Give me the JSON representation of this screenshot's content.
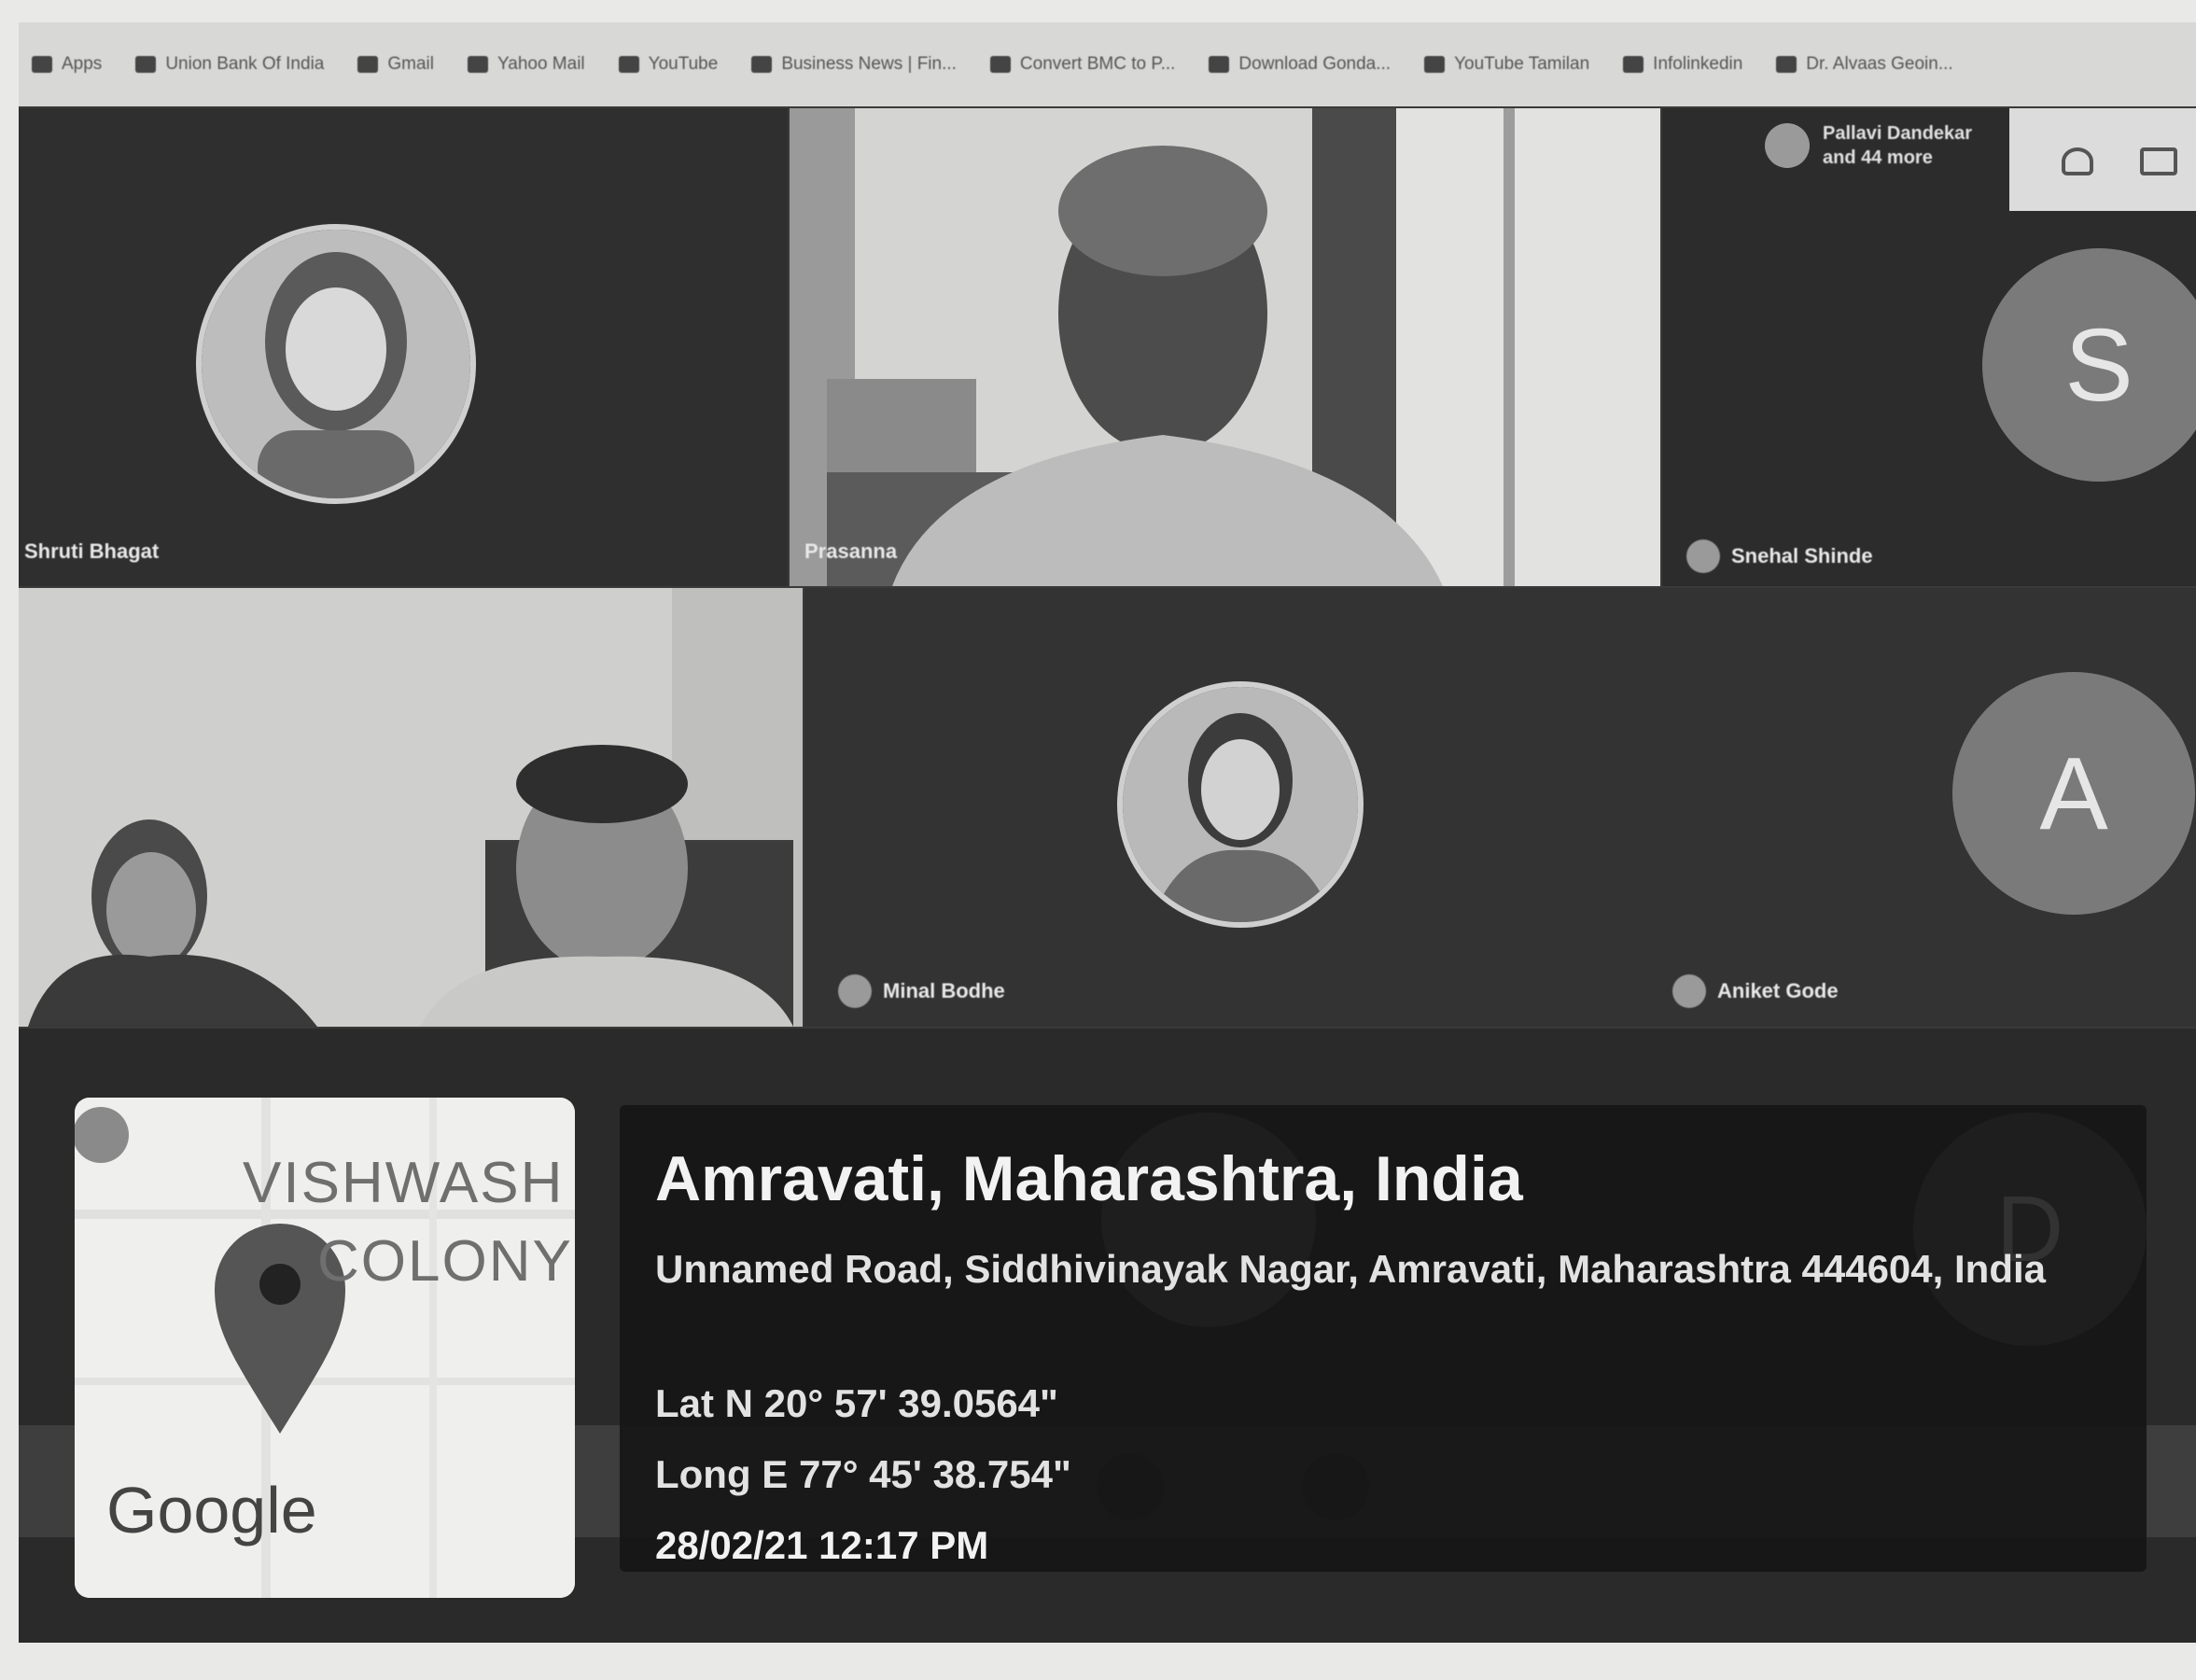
{
  "bookmarks": [
    {
      "icon": "bookmark-icon",
      "label": "Apps"
    },
    {
      "icon": "bank-icon",
      "label": "Union Bank Of India"
    },
    {
      "icon": "gmail-icon",
      "label": "Gmail"
    },
    {
      "icon": "mail-icon",
      "label": "Yahoo Mail"
    },
    {
      "icon": "youtube-icon",
      "label": "YouTube"
    },
    {
      "icon": "news-icon",
      "label": "Business News | Fin..."
    },
    {
      "icon": "web-icon",
      "label": "Convert BMC to P..."
    },
    {
      "icon": "download-icon",
      "label": "Download Gonda..."
    },
    {
      "icon": "youtube-icon",
      "label": "YouTube Tamilan"
    },
    {
      "icon": "web-icon",
      "label": "Infolinkedin"
    },
    {
      "icon": "web-icon",
      "label": "Dr. Alvaas Geoin..."
    }
  ],
  "meeting": {
    "more_participants": "Pallavi Dandekar and 44 more",
    "participants": [
      {
        "name": "Shruti Bhagat",
        "type": "photo"
      },
      {
        "name": "Prasanna",
        "type": "video"
      },
      {
        "name": "Snehal Shinde",
        "avatar_letter": "S",
        "type": "letter"
      },
      {
        "name": "",
        "type": "video"
      },
      {
        "name": "Minal Bodhe",
        "type": "photo"
      },
      {
        "name": "Aniket Gode",
        "avatar_letter": "A",
        "type": "letter"
      },
      {
        "avatar_letter": "D",
        "type": "letter"
      }
    ]
  },
  "geo_overlay": {
    "map_text_line1": "VISHWASH",
    "map_text_line2": "COLONY",
    "map_brand": "Google",
    "title": "Amravati, Maharashtra, India",
    "address": "Unnamed Road, Siddhivinayak Nagar, Amravati, Maharashtra 444604, India",
    "latitude": "Lat N 20° 57' 39.0564\"",
    "longitude": "Long E 77° 45' 38.754\"",
    "timestamp": "28/02/21 12:17 PM"
  },
  "colors": {
    "tile_dark": "#333333",
    "overlay_bg": "#141414",
    "map_pin": "#555555"
  }
}
